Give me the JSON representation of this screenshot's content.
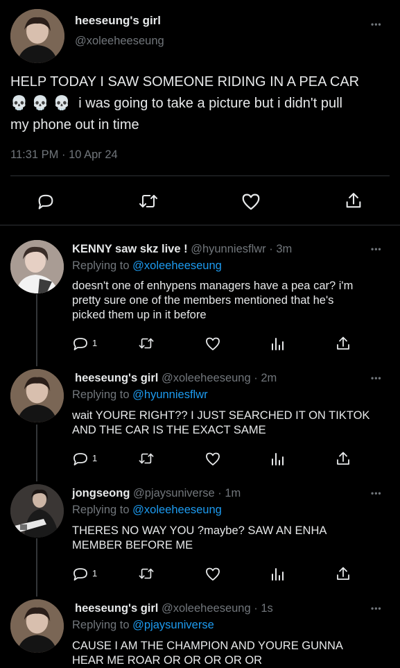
{
  "main_tweet": {
    "display_name": "heeseung's girl",
    "handle": "@xoleeheeseung",
    "more": "•••",
    "text_line1": "HELP TODAY I SAW SOMEONE RIDING IN A PEA CAR",
    "emojis": "💀💀💀",
    "text_line2": " i was going to take a picture but i didn't pull",
    "text_line3": "my phone out in time",
    "timestamp": "11:31 PM · 10 Apr 24"
  },
  "replies": [
    {
      "display_name": "KENNY saw skz live !",
      "handle": "@hyunniesflwr",
      "time": "· 3m",
      "replying_prefix": "Replying to ",
      "replying_to": "@xoleeheeseung",
      "lines": [
        "doesn't one of enhypens managers have a pea car? i'm",
        "pretty sure one of the members mentioned that he's",
        "picked them up in it before"
      ],
      "reply_count": "1",
      "more": "•••"
    },
    {
      "display_name": "heeseung's girl",
      "handle": "@xoleeheeseung",
      "time": "· 2m",
      "replying_prefix": "Replying to ",
      "replying_to": "@hyunniesflwr",
      "lines": [
        "wait YOURE RIGHT?? I JUST SEARCHED IT ON TIKTOK",
        "AND THE CAR IS THE EXACT SAME"
      ],
      "reply_count": "1",
      "more": "•••"
    },
    {
      "display_name": "jongseong",
      "handle": "@pjaysuniverse",
      "time": "· 1m",
      "replying_prefix": "Replying to ",
      "replying_to": "@xoleeheeseung",
      "lines": [
        "THERES NO WAY YOU ?maybe? SAW AN ENHA",
        "MEMBER BEFORE ME"
      ],
      "reply_count": "1",
      "more": "•••"
    },
    {
      "display_name": "heeseung's girl",
      "handle": "@xoleeheeseung",
      "time": "· 1s",
      "replying_prefix": "Replying to ",
      "replying_to": "@pjaysuniverse",
      "lines": [
        "CAUSE I AM THE CHAMPION AND YOURE GUNNA",
        "HEAR ME ROAR OR OR OR OR OR"
      ],
      "more": "•••"
    }
  ],
  "colors": {
    "background": "#000000",
    "text": "#e7e9ea",
    "secondary": "#71767b",
    "link": "#1d9bf0",
    "divider": "#2f3336"
  }
}
